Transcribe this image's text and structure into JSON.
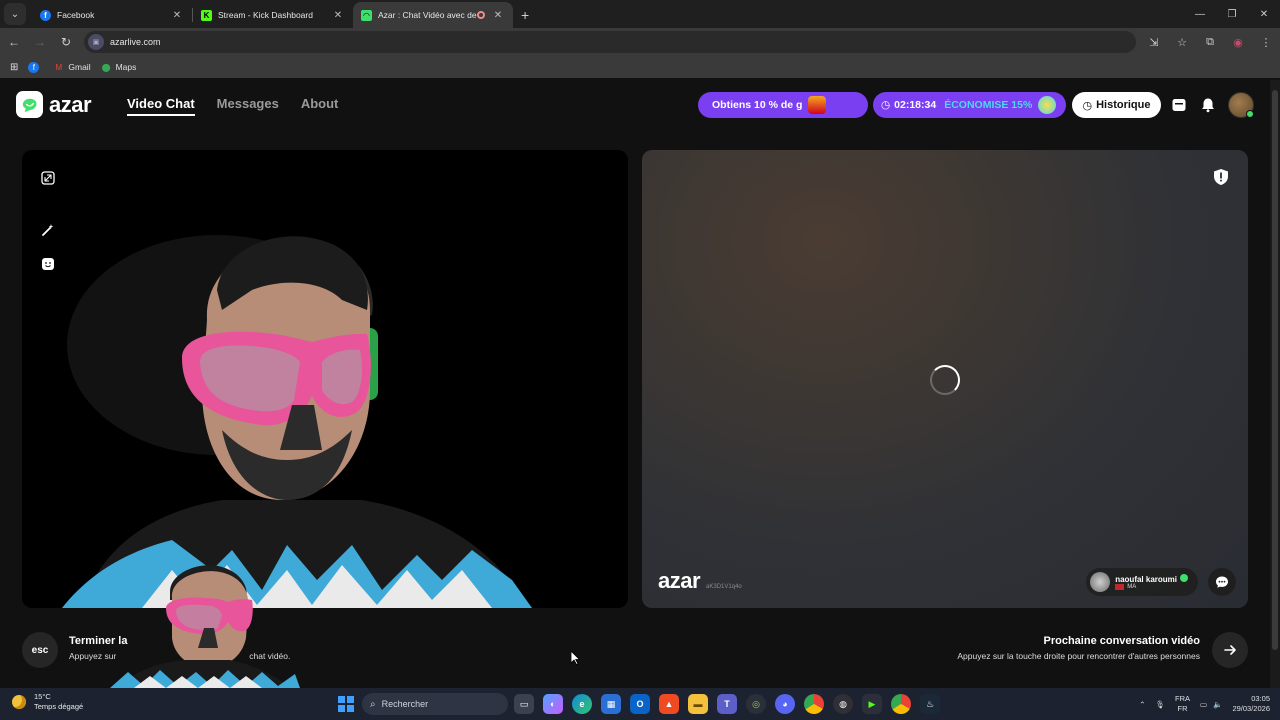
{
  "browser": {
    "tabs": [
      {
        "title": "Facebook",
        "active": false
      },
      {
        "title": "Stream - Kick Dashboard",
        "active": false
      },
      {
        "title": "Azar : Chat Vidéo avec de n",
        "active": true
      }
    ],
    "new_tab": "+",
    "url": "azarlive.com",
    "bookmarks": [
      "Gmail",
      "Maps"
    ],
    "window_controls": {
      "minimize": "—",
      "restore": "❐",
      "close": "✕"
    }
  },
  "header": {
    "logo": "azar",
    "nav": [
      "Video Chat",
      "Messages",
      "About"
    ],
    "promo_offer": "Obtiens 10 % de g",
    "timer": "02:18:34",
    "timer_saving": "ÉCONOMISE 15%",
    "history_label": "Historique"
  },
  "remote": {
    "watermark_logo": "azar",
    "watermark_id": "aK3D1V1q4o",
    "user_name": "naoufal karoumi",
    "user_country": "MA"
  },
  "controls": {
    "esc_key": "esc",
    "end_title": "Terminer la",
    "end_sub_a": "Appuyez sur",
    "end_sub_b": "chat vidéo.",
    "next_title": "Prochaine conversation vidéo",
    "next_sub": "Appuyez sur la touche droite pour rencontrer d'autres personnes"
  },
  "taskbar": {
    "temperature": "15°C",
    "weather": "Temps dégagé",
    "search_placeholder": "Rechercher",
    "lang_top": "FRA",
    "lang_bottom": "FR",
    "time": "03:05",
    "date": "29/03/2026"
  },
  "colors": {
    "brand_green": "#3ee06b",
    "promo_purple": "#7b3ff2",
    "saving_cyan": "#4dd7f0",
    "mask_pink": "#e8559a"
  }
}
